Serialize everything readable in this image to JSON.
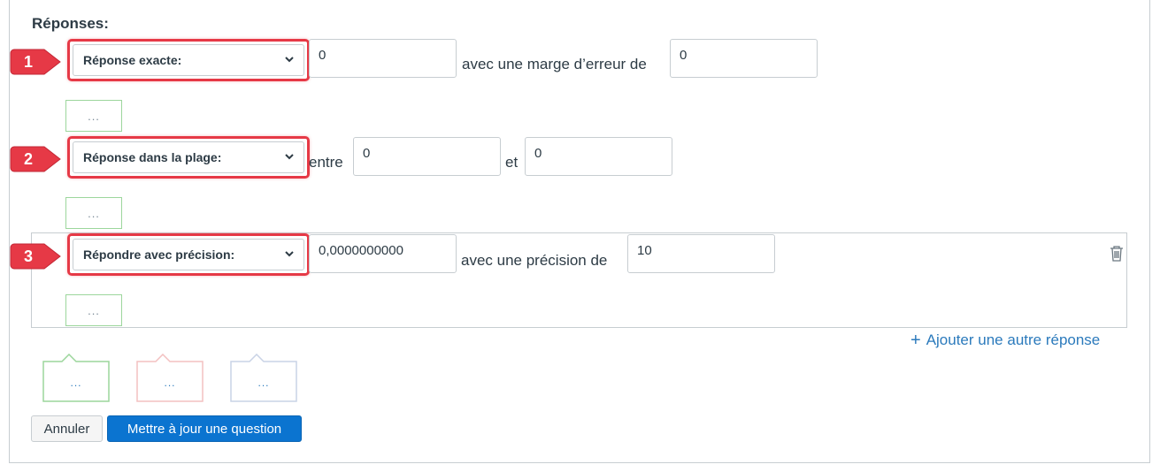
{
  "section_title": "Réponses:",
  "answers": [
    {
      "badge": "1",
      "type_label": "Réponse exacte:",
      "value1": "0",
      "between_text": "avec une marge d’erreur de",
      "value2": "0",
      "comment": "..."
    },
    {
      "badge": "2",
      "type_label": "Réponse dans la plage:",
      "before_text": "entre",
      "value1": "0",
      "between_text": "et",
      "value2": "0",
      "comment": "..."
    },
    {
      "badge": "3",
      "type_label": "Répondre avec précision:",
      "value1": "0,0000000000",
      "between_text": "avec une précision de",
      "value2": "10",
      "comment": "..."
    }
  ],
  "add_answer": {
    "plus": "+",
    "label": "Ajouter une autre réponse"
  },
  "general_comments": [
    {
      "type": "correct",
      "label": "...",
      "color": "#9cd69c",
      "dot_color": "#2b7abc"
    },
    {
      "type": "incorrect",
      "label": "...",
      "color": "#f3c1c1",
      "dot_color": "#2b7abc"
    },
    {
      "type": "neutral",
      "label": "...",
      "color": "#c9d3e6",
      "dot_color": "#2b7abc"
    }
  ],
  "buttons": {
    "cancel": "Annuler",
    "update": "Mettre à jour une question"
  },
  "icons": {
    "dropdown": "chevron-down-icon",
    "delete": "trash-icon",
    "callout_badge": "red-numbered-arrow-badge"
  },
  "colors": {
    "highlight": "#e63946",
    "accent": "#0b74d0",
    "link": "#2b7abc",
    "comment_border": "#9cd69c"
  }
}
